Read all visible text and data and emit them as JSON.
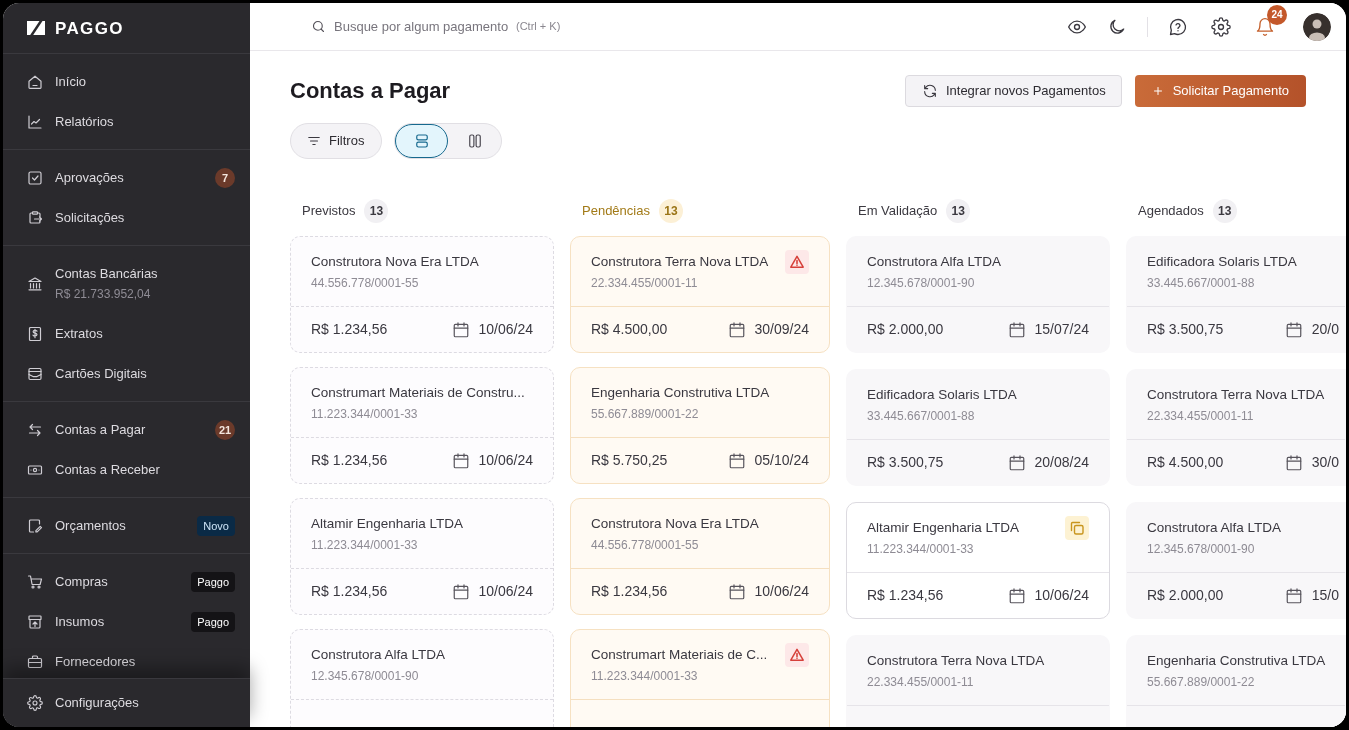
{
  "sidebar": {
    "logo": "PAGGO",
    "sections": [
      {
        "items": [
          {
            "label": "Início"
          },
          {
            "label": "Relatórios"
          }
        ]
      },
      {
        "items": [
          {
            "label": "Aprovações",
            "badge": {
              "kind": "count",
              "text": "7"
            }
          },
          {
            "label": "Solicitações"
          }
        ]
      },
      {
        "items": [
          {
            "label": "Contas Bancárias",
            "balance": "R$ 21.733.952,04"
          },
          {
            "label": "Extratos"
          },
          {
            "label": "Cartões Digitais"
          }
        ]
      },
      {
        "items": [
          {
            "label": "Contas a Pagar",
            "badge": {
              "kind": "count",
              "text": "21"
            }
          },
          {
            "label": "Contas a Receber"
          }
        ]
      },
      {
        "items": [
          {
            "label": "Orçamentos",
            "badge": {
              "kind": "new",
              "text": "Novo"
            }
          }
        ]
      },
      {
        "items": [
          {
            "label": "Compras",
            "badge": {
              "kind": "brand",
              "text": "Paggo"
            }
          },
          {
            "label": "Insumos",
            "badge": {
              "kind": "brand",
              "text": "Paggo"
            }
          },
          {
            "label": "Fornecedores"
          }
        ]
      }
    ],
    "footer_item": {
      "label": "Configurações"
    }
  },
  "top_bar": {
    "search": {
      "placeholder": "Busque por algum pagamento",
      "shortcut": "(Ctrl + K)"
    },
    "notifications": "24"
  },
  "page": {
    "title": "Contas a Pagar",
    "actions": [
      {
        "kind": "secondary",
        "label": "Integrar novos Pagamentos"
      },
      {
        "kind": "primary",
        "label": "Solicitar Pagamento"
      }
    ],
    "filter_button": "Filtros",
    "view_modes": [
      {
        "selected": true
      },
      {
        "selected": false
      }
    ]
  },
  "board": {
    "columns": [
      {
        "title": "Previstos",
        "count": "13",
        "kind": "planned",
        "cards": [
          {
            "name": "Construtora Nova Era LTDA",
            "cnpj": "44.556.778/0001-55",
            "amount": "R$ 1.234,56",
            "date": "10/06/24",
            "selected": false
          },
          {
            "name": "Construmart Materiais de Constru...",
            "cnpj": "11.223.344/0001-33",
            "amount": "R$ 1.234,56",
            "date": "10/06/24",
            "selected": false
          },
          {
            "name": "Altamir Engenharia LTDA",
            "cnpj": "11.223.344/0001-33",
            "amount": "R$ 1.234,56",
            "date": "10/06/24",
            "selected": false
          },
          {
            "name": "Construtora Alfa LTDA",
            "cnpj": "12.345.678/0001-90",
            "selected": false
          }
        ]
      },
      {
        "title": "Pendências",
        "count": "13",
        "kind": "pending",
        "cards": [
          {
            "name": "Construtora Terra Nova LTDA",
            "cnpj": "22.334.455/0001-11",
            "amount": "R$ 4.500,00",
            "date": "30/09/24",
            "flag": {
              "kind": "warning"
            },
            "selected": false
          },
          {
            "name": "Engenharia Construtiva LTDA",
            "cnpj": "55.667.889/0001-22",
            "amount": "R$ 5.750,25",
            "date": "05/10/24",
            "selected": false
          },
          {
            "name": "Construtora Nova Era LTDA",
            "cnpj": "44.556.778/0001-55",
            "amount": "R$ 1.234,56",
            "date": "10/06/24",
            "selected": false
          },
          {
            "name": "Construmart Materiais de C...",
            "cnpj": "11.223.344/0001-33",
            "flag": {
              "kind": "warning"
            },
            "selected": false
          }
        ]
      },
      {
        "title": "Em Validação",
        "count": "13",
        "kind": "validating",
        "cards": [
          {
            "name": "Construtora Alfa LTDA",
            "cnpj": "12.345.678/0001-90",
            "amount": "R$ 2.000,00",
            "date": "15/07/24",
            "selected": false
          },
          {
            "name": "Edificadora Solaris LTDA",
            "cnpj": "33.445.667/0001-88",
            "amount": "R$ 3.500,75",
            "date": "20/08/24",
            "selected": false
          },
          {
            "name": "Altamir Engenharia LTDA",
            "cnpj": "11.223.344/0001-33",
            "amount": "R$ 1.234,56",
            "date": "10/06/24",
            "flag": {
              "kind": "copy"
            },
            "selected": true
          },
          {
            "name": "Construtora Terra Nova LTDA",
            "cnpj": "22.334.455/0001-11",
            "selected": false
          }
        ]
      },
      {
        "title": "Agendados",
        "count": "13",
        "kind": "scheduled",
        "cards": [
          {
            "name": "Edificadora Solaris LTDA",
            "cnpj": "33.445.667/0001-88",
            "amount": "R$ 3.500,75",
            "date": "20/0",
            "selected": false
          },
          {
            "name": "Construtora Terra Nova LTDA",
            "cnpj": "22.334.455/0001-11",
            "amount": "R$ 4.500,00",
            "date": "30/0",
            "selected": false
          },
          {
            "name": "Construtora Alfa LTDA",
            "cnpj": "12.345.678/0001-90",
            "amount": "R$ 2.000,00",
            "date": "15/0",
            "selected": false
          },
          {
            "name": "Engenharia Construtiva LTDA",
            "cnpj": "55.667.889/0001-22",
            "selected": false
          }
        ]
      }
    ]
  }
}
